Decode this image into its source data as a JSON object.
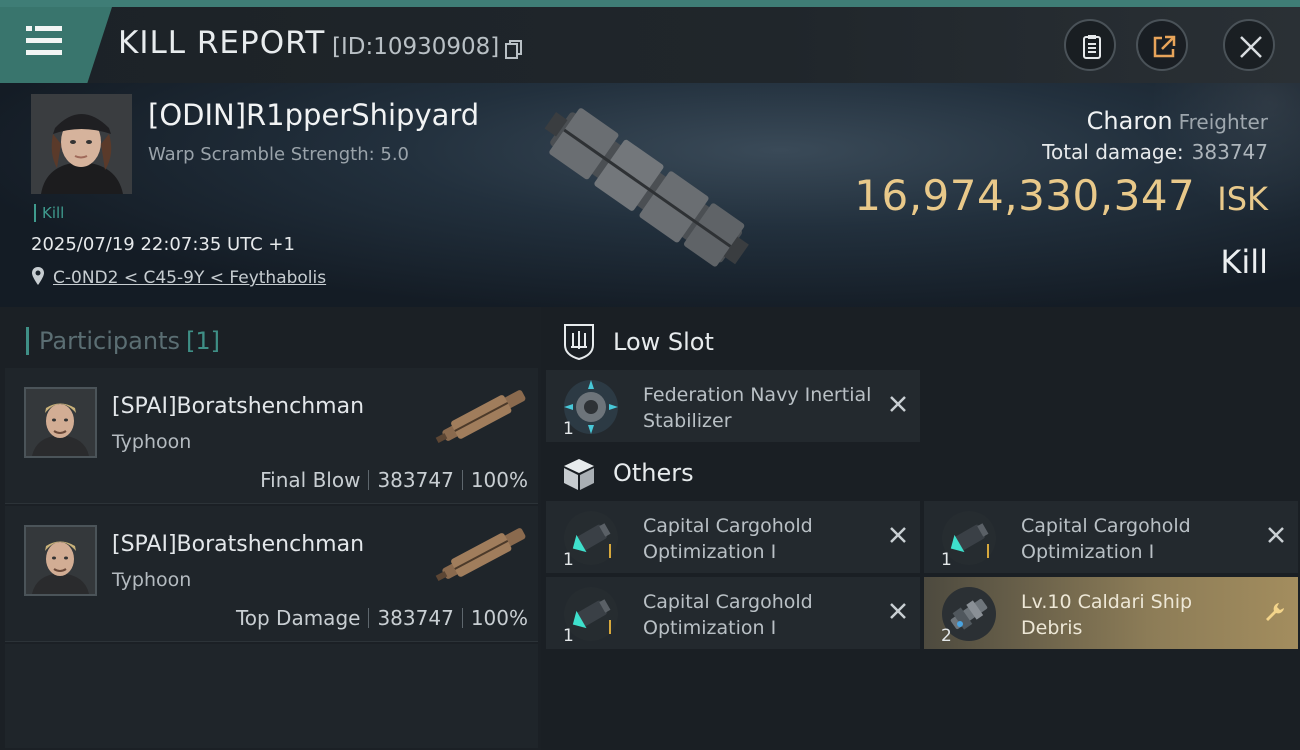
{
  "header": {
    "title": "KILL REPORT",
    "report_id": "[ID:10930908]",
    "icons": [
      "menu-icon",
      "copy-icon",
      "clipboard-icon",
      "share-icon",
      "close-icon"
    ]
  },
  "victim": {
    "pilot": "[ODIN]R1pperShipyard",
    "warp_scramble": "Warp Scramble Strength: 5.0",
    "tag": "Kill",
    "datetime": "2025/07/19 22:07:35 UTC +1",
    "location": "C-0ND2 < C45-9Y < Feythabolis",
    "ship_name": "Charon",
    "ship_class": "Freighter",
    "total_damage_label": "Total damage:",
    "total_damage": "383747",
    "isk_value": "16,974,330,347",
    "isk_unit": "ISK",
    "result": "Kill"
  },
  "participants": {
    "title": "Participants",
    "count": "[1]",
    "cards": [
      {
        "name": "[SPAI]Boratshenchman",
        "ship": "Typhoon",
        "role": "Final Blow",
        "damage": "383747",
        "percent": "100%"
      },
      {
        "name": "[SPAI]Boratshenchman",
        "ship": "Typhoon",
        "role": "Top Damage",
        "damage": "383747",
        "percent": "100%"
      }
    ]
  },
  "fitting": {
    "low_slot": {
      "title": "Low Slot",
      "items": [
        {
          "name": "Federation Navy Inertial Stabilizer",
          "qty": "1",
          "status": "destroyed"
        }
      ]
    },
    "others": {
      "title": "Others",
      "items": [
        {
          "name": "Capital Cargohold Optimization I",
          "qty": "1",
          "status": "destroyed"
        },
        {
          "name": "Capital Cargohold Optimization I",
          "qty": "1",
          "status": "destroyed"
        },
        {
          "name": "Capital Cargohold Optimization I",
          "qty": "1",
          "status": "destroyed"
        },
        {
          "name": "Lv.10 Caldari Ship Debris",
          "qty": "2",
          "status": "dropped"
        }
      ]
    }
  },
  "colors": {
    "accent": "#3f7d76",
    "isk": "#e9c98a",
    "dropped_bg": "#a38d5e"
  }
}
